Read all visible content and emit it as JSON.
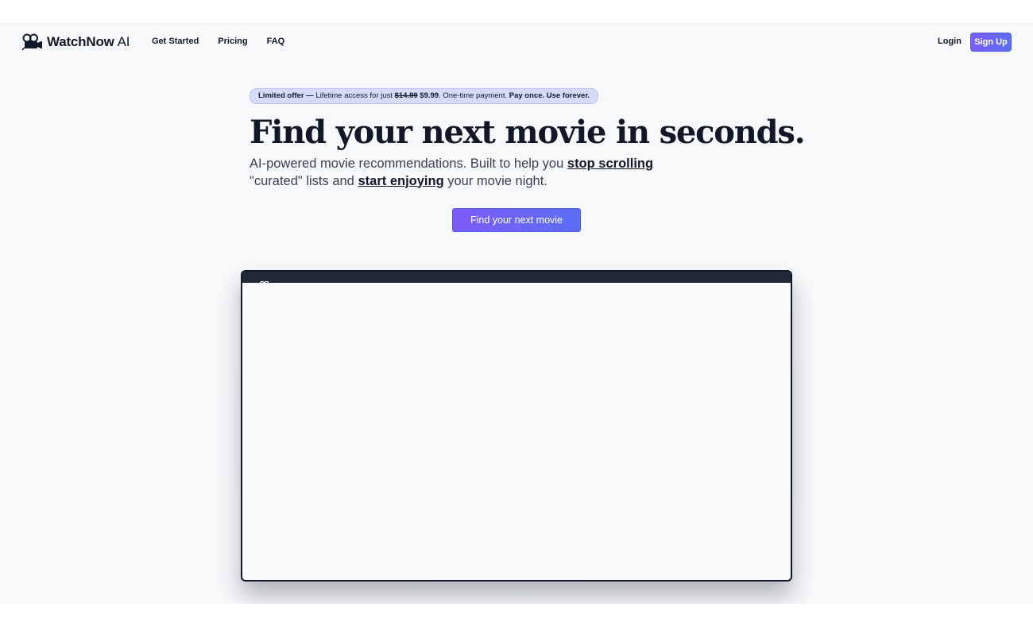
{
  "brand": {
    "name": "WatchNow",
    "suffix": "AI",
    "logo_icon": "film-camera-icon"
  },
  "nav": {
    "links": [
      "Get Started",
      "Pricing",
      "FAQ"
    ],
    "login": "Login",
    "signup": "Sign Up"
  },
  "offer": {
    "label": "Limited offer",
    "dash": "—",
    "text_pre": "Lifetime access for just",
    "old_price": "$14.99",
    "new_price": "$9.99",
    "text_post": ". One-time payment.",
    "tagline": "Pay once. Use forever."
  },
  "hero": {
    "title": "Find your next movie in seconds.",
    "sub_1": "AI-powered movie recommendations. Built to help you",
    "sub_link_1": "stop scrolling",
    "sub_2": "\"curated\" lists and",
    "sub_link_2": "start enjoying",
    "sub_3": "your movie night.",
    "cta": "Find your next movie"
  },
  "colors": {
    "accent_start": "#7c5cf6",
    "accent_end": "#5b6ef5",
    "text": "#111827",
    "offer_bg": "#d6dcf8"
  }
}
